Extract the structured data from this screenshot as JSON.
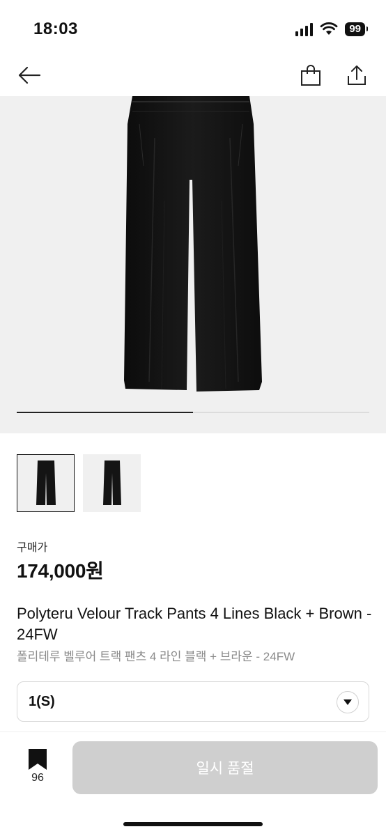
{
  "status_bar": {
    "time": "18:03",
    "battery": "99",
    "icons": [
      "signal-icon",
      "wifi-icon",
      "battery-icon"
    ]
  },
  "nav": {
    "icons": [
      "back-arrow-icon",
      "shopping-bag-icon",
      "share-icon"
    ]
  },
  "gallery": {
    "image_count": 8,
    "current_index": 1,
    "progress_fraction": 0.5,
    "thumbnail_count": 2,
    "selected_thumbnail": 1
  },
  "product": {
    "price_label": "구매가",
    "price": "174,000원",
    "title_en": "Polyteru Velour Track Pants 4 Lines Black + Brown - 24FW",
    "title_ko": "폴리테루 벨루어 트랙 팬츠 4 라인 블랙 + 브라운 - 24FW"
  },
  "size_select": {
    "value": "1(S)",
    "icon": "chevron-down-icon"
  },
  "bottom_bar": {
    "bookmark_count": "96",
    "bookmark_icon": "bookmark-icon",
    "soldout_label": "일시 품절"
  },
  "colors": {
    "text": "#111111",
    "secondary_text": "#8a8a8a",
    "image_background": "#f0f0f0",
    "disabled_button": "#cfcfcf"
  }
}
